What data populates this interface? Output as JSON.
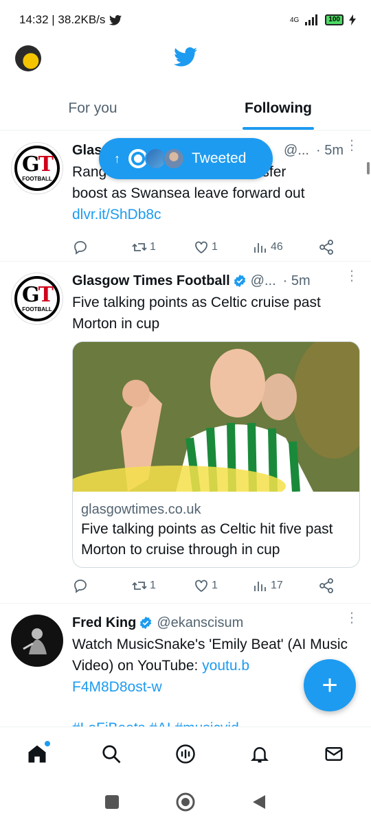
{
  "status_bar": {
    "time_speed": "14:32 | 38.2KB/s",
    "network": "4G",
    "battery": "100"
  },
  "tabs": [
    {
      "label": "For you",
      "active": false
    },
    {
      "label": "Following",
      "active": true
    }
  ],
  "new_tweets_pill": {
    "label": "Tweeted"
  },
  "tweets": [
    {
      "name": "Glasgow Times Football",
      "name_visible": "Glas",
      "handle": "@...",
      "time": "· 5m",
      "text_start": "Rang",
      "text_end": "transfer",
      "text_line2": "boost as Swansea leave forward out",
      "link": "dlvr.it/ShDb8c",
      "retweets": "1",
      "likes": "1",
      "views": "46"
    },
    {
      "name": "Glasgow Times Football",
      "handle": "@...",
      "time": "· 5m",
      "text": "Five talking points as Celtic cruise past Morton in cup",
      "card_domain": "glasgowtimes.co.uk",
      "card_title": "Five talking points as Celtic hit five past Morton to cruise through in cup",
      "retweets": "1",
      "likes": "1",
      "views": "17"
    },
    {
      "name": "Fred King",
      "handle": "@ekanscisum",
      "text_prefix": "Watch MusicSnake's 'Emily Beat' (AI Music Video) on YouTube: ",
      "link_part1": "youtu.b",
      "link_part2": "F4M8D8ost-w",
      "hashtags_partial": "#LoFiBeats #AI #musicvid"
    }
  ],
  "avatar_logo_text": {
    "gt": "GT",
    "football": "FOOTBALL"
  },
  "colors": {
    "accent": "#1d9bf0",
    "text": "#0f1419",
    "muted": "#536471"
  },
  "icons": [
    "home-icon",
    "search-icon",
    "spaces-icon",
    "notifications-icon",
    "messages-icon"
  ]
}
